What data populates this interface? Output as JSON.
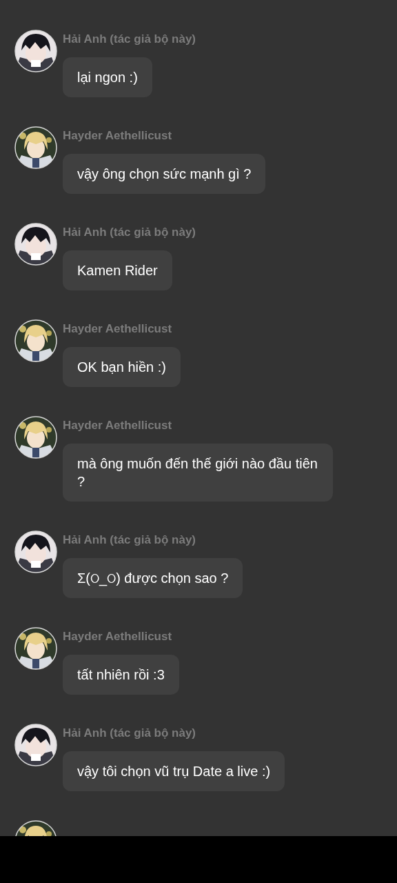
{
  "messages": [
    {
      "kind": "author",
      "name": "Hải Anh (tác giả bộ này)",
      "text": "lại ngon :)"
    },
    {
      "kind": "guest",
      "name": "Hayder Aethellicust",
      "text": "vậy ông chọn sức mạnh gì ?"
    },
    {
      "kind": "author",
      "name": "Hải Anh (tác giả bộ này)",
      "text": "Kamen Rider"
    },
    {
      "kind": "guest",
      "name": "Hayder Aethellicust",
      "text": "OK bạn hiền :)"
    },
    {
      "kind": "guest",
      "name": "Hayder Aethellicust",
      "text": "mà ông muốn đến thế giới nào đầu tiên ?"
    },
    {
      "kind": "author",
      "name": "Hải Anh (tác giả bộ này)",
      "text": "Σ(ଠ_ଠ) được chọn sao ?"
    },
    {
      "kind": "guest",
      "name": "Hayder Aethellicust",
      "text": "tất nhiên rồi :3"
    },
    {
      "kind": "author",
      "name": "Hải Anh (tác giả bộ này)",
      "text": "vậy tôi chọn vũ trụ Date a live :)"
    }
  ]
}
